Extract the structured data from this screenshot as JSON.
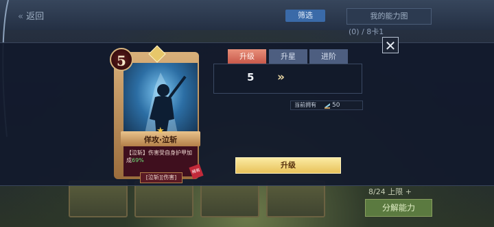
{
  "background": {
    "back_label": "返回",
    "filter_label": "筛选",
    "dropdown_label": "我的能力图",
    "sub_label": "(0) / 8卡1",
    "count_label": "8/24 上限 +",
    "generate_button": "分解能力"
  },
  "modal": {
    "tabs": [
      {
        "label": "升级",
        "active": true
      },
      {
        "label": "升星",
        "active": false
      },
      {
        "label": "进阶",
        "active": false
      }
    ],
    "level": {
      "current": "5",
      "arrow": "»"
    },
    "owned": {
      "label": "当前拥有",
      "value": "50",
      "icon": "whetstone-icon"
    },
    "upgrade_button": "升级",
    "close_icon": "close-icon"
  },
  "card": {
    "cost": "5",
    "name": "佯攻·泣斩",
    "description_prefix": "【泣斩】伤害受自身护甲加成",
    "description_value": "69%",
    "tag": "[泣斩][伤害]",
    "corner_badge": "稀有"
  },
  "colors": {
    "tab_active": "#d8705e",
    "tab_inactive": "#4d5e80",
    "upgrade_button": "#f2d677",
    "highlight_green": "#6fe07a"
  }
}
